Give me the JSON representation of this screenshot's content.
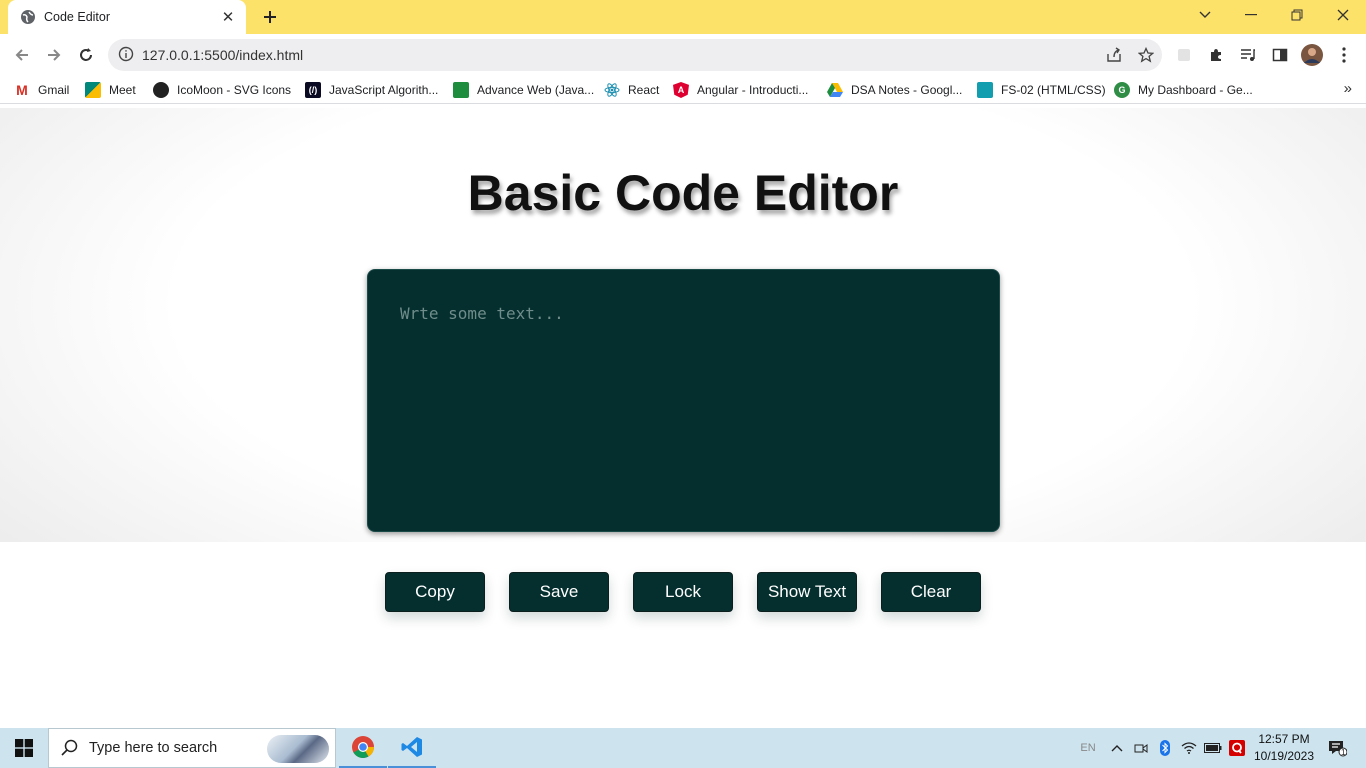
{
  "browser": {
    "tab_title": "Code Editor",
    "url": "127.0.0.1:5500/index.html"
  },
  "bookmarks": [
    {
      "label": "Gmail",
      "icon": "gmail-icon",
      "color": "#d93025"
    },
    {
      "label": "Meet",
      "icon": "meet-icon",
      "color": "#00897b"
    },
    {
      "label": "IcoMoon - SVG Icons",
      "icon": "icomoon-icon",
      "color": "#222222"
    },
    {
      "label": "JavaScript Algorith...",
      "icon": "freecodecamp-icon",
      "color": "#0a0a23"
    },
    {
      "label": "Advance Web (Java...",
      "icon": "classroom-icon",
      "color": "#1e8e3e"
    },
    {
      "label": "React",
      "icon": "react-icon",
      "color": "#61dafb"
    },
    {
      "label": "Angular - Introducti...",
      "icon": "angular-icon",
      "color": "#dd0031"
    },
    {
      "label": "DSA Notes - Googl...",
      "icon": "google-drive-icon",
      "color": "#fbbc04"
    },
    {
      "label": "FS-02 (HTML/CSS)",
      "icon": "classroom-icon",
      "color": "#129eaf"
    },
    {
      "label": "My Dashboard - Ge...",
      "icon": "geeksforgeeks-icon",
      "color": "#2f8d46"
    }
  ],
  "page": {
    "title": "Basic Code Editor",
    "editor_placeholder": "Wrte some text...",
    "editor_value": "",
    "buttons": {
      "copy": "Copy",
      "save": "Save",
      "lock": "Lock",
      "show_text": "Show Text",
      "clear": "Clear"
    },
    "accent_color": "#042f2e"
  },
  "taskbar": {
    "search_placeholder": "Type here to search",
    "language": "EN",
    "time": "12:57 PM",
    "date": "10/19/2023",
    "notification_count": "1"
  }
}
